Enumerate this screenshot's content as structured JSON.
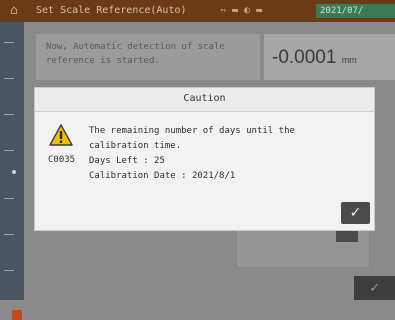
{
  "titlebar": {
    "home_icon": "home-icon",
    "title": "Set Scale Reference(Auto)",
    "status": "⇔ ▬ ◐ ▬",
    "date": "2021/07/"
  },
  "background": {
    "message": "Now, Automatic detection of scale reference is started.",
    "value": "-0.0001",
    "value_unit": "mm",
    "ok_symbol": "✓"
  },
  "dialog": {
    "title": "Caution",
    "icon": "warning-triangle-icon",
    "code": "C0035",
    "message_lines": [
      "The remaining number of days until the",
      "calibration time.",
      "Days Left :   25",
      "Calibration Date : 2021/8/1"
    ],
    "ok_symbol": "✓",
    "accent_color": "#f0c000"
  }
}
